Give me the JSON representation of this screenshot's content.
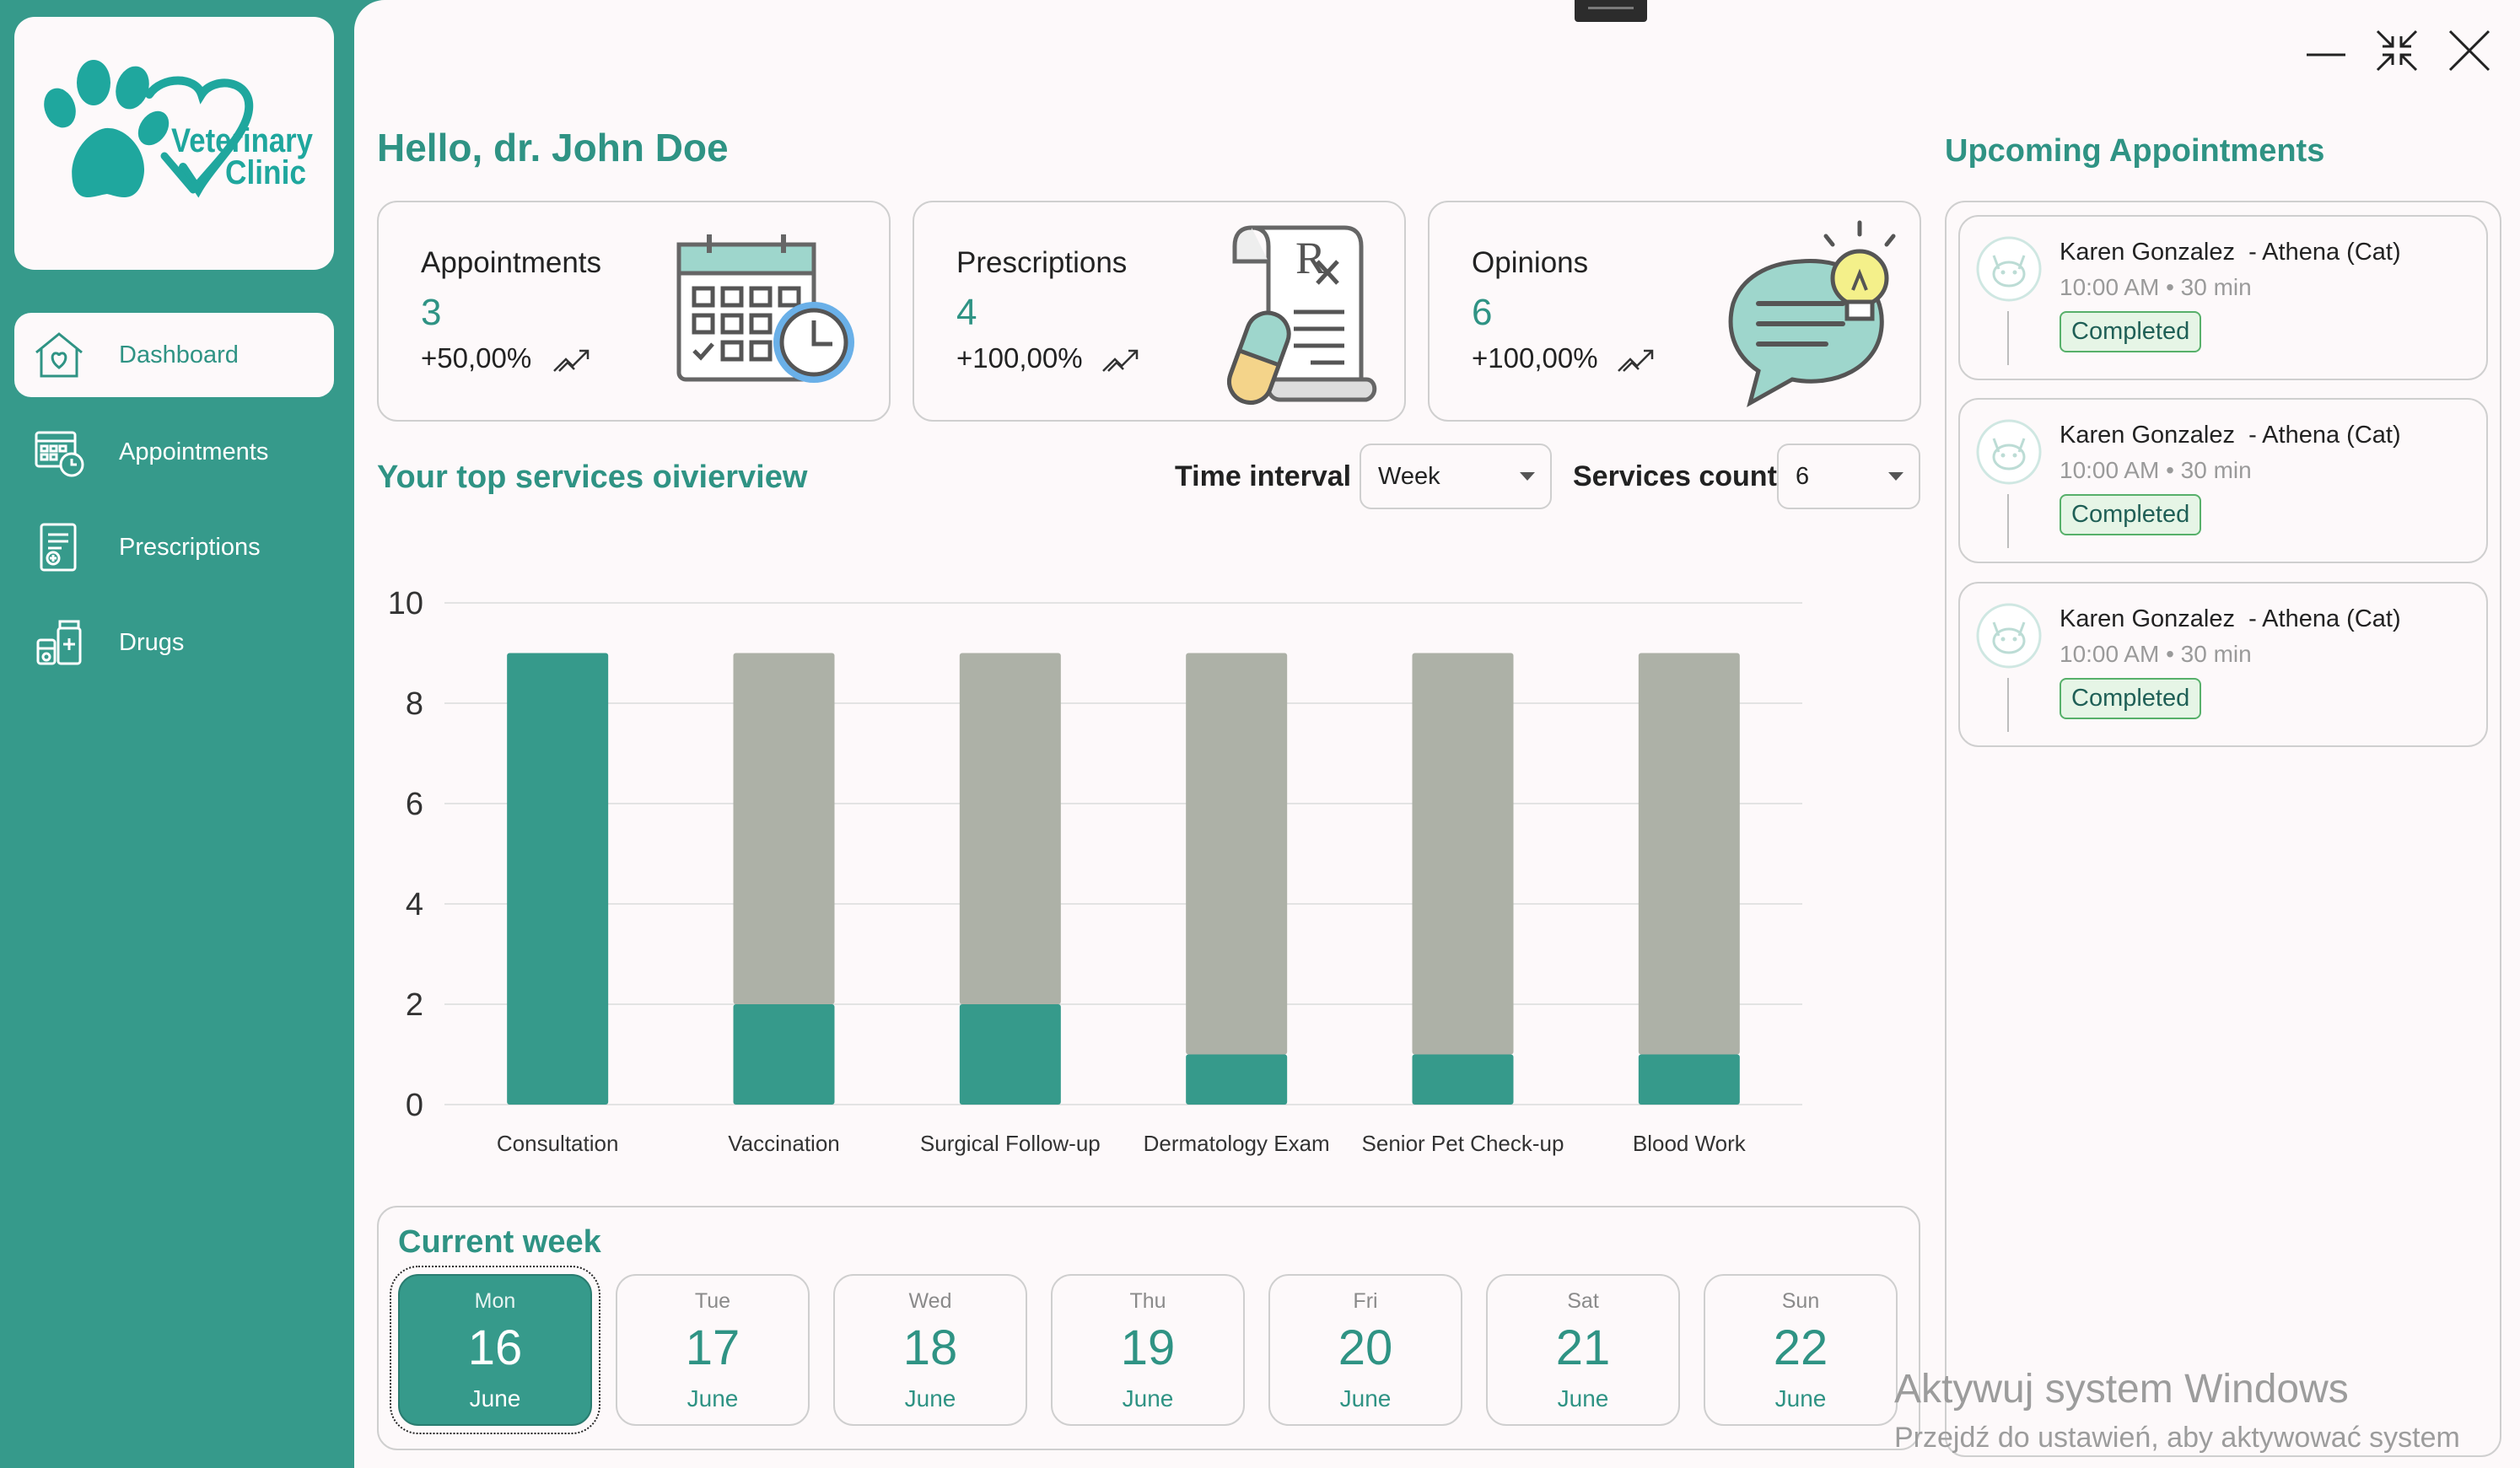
{
  "colors": {
    "accent": "#369a8b",
    "accent_dark": "#2f9384",
    "gray_bar": "#adb1a7",
    "background": "#fdf9fa"
  },
  "logo": {
    "line1": "Veterinary",
    "line2": "Clinic"
  },
  "sidebar": {
    "items": [
      {
        "label": "Dashboard",
        "icon": "house-heart-icon",
        "active": true
      },
      {
        "label": "Appointments",
        "icon": "calendar-clock-icon",
        "active": false
      },
      {
        "label": "Prescriptions",
        "icon": "prescription-doc-icon",
        "active": false
      },
      {
        "label": "Drugs",
        "icon": "medicine-bottles-icon",
        "active": false
      }
    ]
  },
  "window_controls": [
    "minimize-icon",
    "restore-icon",
    "close-icon"
  ],
  "greeting": "Hello, dr. John Doe",
  "stats": [
    {
      "title": "Appointments",
      "value": "3",
      "change": "+50,00%",
      "icon": "calendar-clock-illustration"
    },
    {
      "title": "Prescriptions",
      "value": "4",
      "change": "+100,00%",
      "icon": "prescription-illustration"
    },
    {
      "title": "Opinions",
      "value": "6",
      "change": "+100,00%",
      "icon": "speech-bubble-bulb-illustration"
    }
  ],
  "services": {
    "title": "Your top services oivierview",
    "time_interval_label": "Time interval",
    "time_interval_value": "Week",
    "services_count_label": "Services count",
    "services_count_value": "6"
  },
  "chart_data": {
    "type": "bar",
    "stacked": true,
    "categories": [
      "Consultation",
      "Vaccination",
      "Surgical Follow-up",
      "Dermatology Exam",
      "Senior Pet Check-up",
      "Blood Work"
    ],
    "series": [
      {
        "values": [
          9,
          2,
          2,
          1,
          1,
          1
        ],
        "color": "#369a8b"
      },
      {
        "values": [
          0,
          7,
          7,
          8,
          8,
          8
        ],
        "color": "#adb1a7"
      }
    ],
    "yticks": [
      "0",
      "2",
      "4",
      "6",
      "8",
      "10"
    ],
    "ylim": [
      0,
      10
    ],
    "grid": true
  },
  "week": {
    "title": "Current week",
    "days": [
      {
        "name": "Mon",
        "num": "16",
        "month": "June",
        "active": true
      },
      {
        "name": "Tue",
        "num": "17",
        "month": "June",
        "active": false
      },
      {
        "name": "Wed",
        "num": "18",
        "month": "June",
        "active": false
      },
      {
        "name": "Thu",
        "num": "19",
        "month": "June",
        "active": false
      },
      {
        "name": "Fri",
        "num": "20",
        "month": "June",
        "active": false
      },
      {
        "name": "Sat",
        "num": "21",
        "month": "June",
        "active": false
      },
      {
        "name": "Sun",
        "num": "22",
        "month": "June",
        "active": false
      }
    ]
  },
  "upcoming": {
    "title": "Upcoming Appointments",
    "items": [
      {
        "name": "Karen Gonzalez  - Athena (Cat)",
        "time": "10:00 AM • 30 min",
        "status": "Completed"
      },
      {
        "name": "Karen Gonzalez  - Athena (Cat)",
        "time": "10:00 AM • 30 min",
        "status": "Completed"
      },
      {
        "name": "Karen Gonzalez  - Athena (Cat)",
        "time": "10:00 AM • 30 min",
        "status": "Completed"
      }
    ]
  },
  "watermark": {
    "line1": "Aktywuj system Windows",
    "line2": "Przejdź do ustawień, aby aktywować system"
  }
}
